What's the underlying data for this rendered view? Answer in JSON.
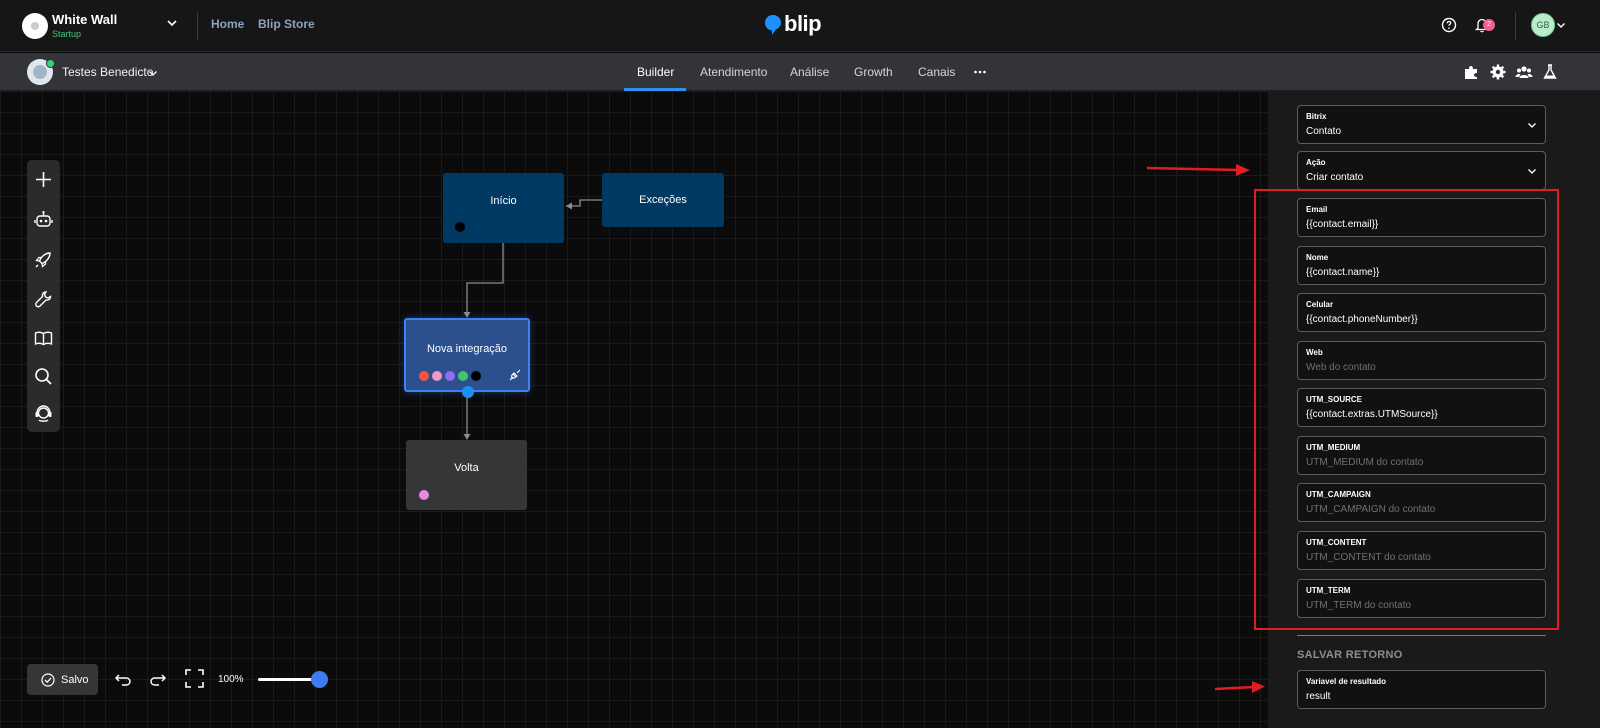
{
  "topbar": {
    "org_name": "White Wall",
    "org_plan": "Startup",
    "nav": [
      "Home",
      "Blip Store"
    ],
    "brand": "blip",
    "notifications_count": "2",
    "avatar_initials": "GB"
  },
  "subbar": {
    "bot_name": "Testes Benedicto",
    "tabs": [
      "Builder",
      "Atendimento",
      "Análise",
      "Growth",
      "Canais"
    ],
    "active_tab": "Builder"
  },
  "toolbar": {
    "icons": [
      "plus-icon",
      "bot-icon",
      "rocket-icon",
      "wrench-icon",
      "book-icon",
      "search-icon",
      "support-icon"
    ]
  },
  "flow": {
    "nodes": {
      "start": "Início",
      "exceptions": "Exceções",
      "integration": "Nova integração",
      "back": "Volta"
    },
    "integration_tag_colors": [
      "#f5553a",
      "#f59ac3",
      "#8f6bf2",
      "#43c66b",
      "#000000"
    ],
    "start_tag_color": "#000000",
    "back_tag_color": "#e589e8"
  },
  "bottom": {
    "saved_label": "Salvo",
    "zoom_label": "100%",
    "zoom_value": 1.0
  },
  "panel": {
    "bitrix": {
      "label": "Bitrix",
      "value": "Contato"
    },
    "acao": {
      "label": "Ação",
      "value": "Criar contato"
    },
    "fields": [
      {
        "label": "Email",
        "value": "{{contact.email}}",
        "placeholder": ""
      },
      {
        "label": "Nome",
        "value": "{{contact.name}}",
        "placeholder": ""
      },
      {
        "label": "Celular",
        "value": "{{contact.phoneNumber}}",
        "placeholder": ""
      },
      {
        "label": "Web",
        "value": "",
        "placeholder": "Web do contato"
      },
      {
        "label": "UTM_SOURCE",
        "value": "{{contact.extras.UTMSource}}",
        "placeholder": ""
      },
      {
        "label": "UTM_MEDIUM",
        "value": "",
        "placeholder": "UTM_MEDIUM do contato"
      },
      {
        "label": "UTM_CAMPAIGN",
        "value": "",
        "placeholder": "UTM_CAMPAIGN do contato"
      },
      {
        "label": "UTM_CONTENT",
        "value": "",
        "placeholder": "UTM_CONTENT do contato"
      },
      {
        "label": "UTM_TERM",
        "value": "",
        "placeholder": "UTM_TERM do contato"
      }
    ],
    "section_title": "SALVAR RETORNO",
    "result": {
      "label": "Variavel de resultado",
      "value": "result"
    }
  },
  "colors": {
    "accent": "#2f8ff0",
    "node_blue": "#003a63",
    "node_selected": "#2c4f8e",
    "annotation_red": "#e11d24"
  }
}
